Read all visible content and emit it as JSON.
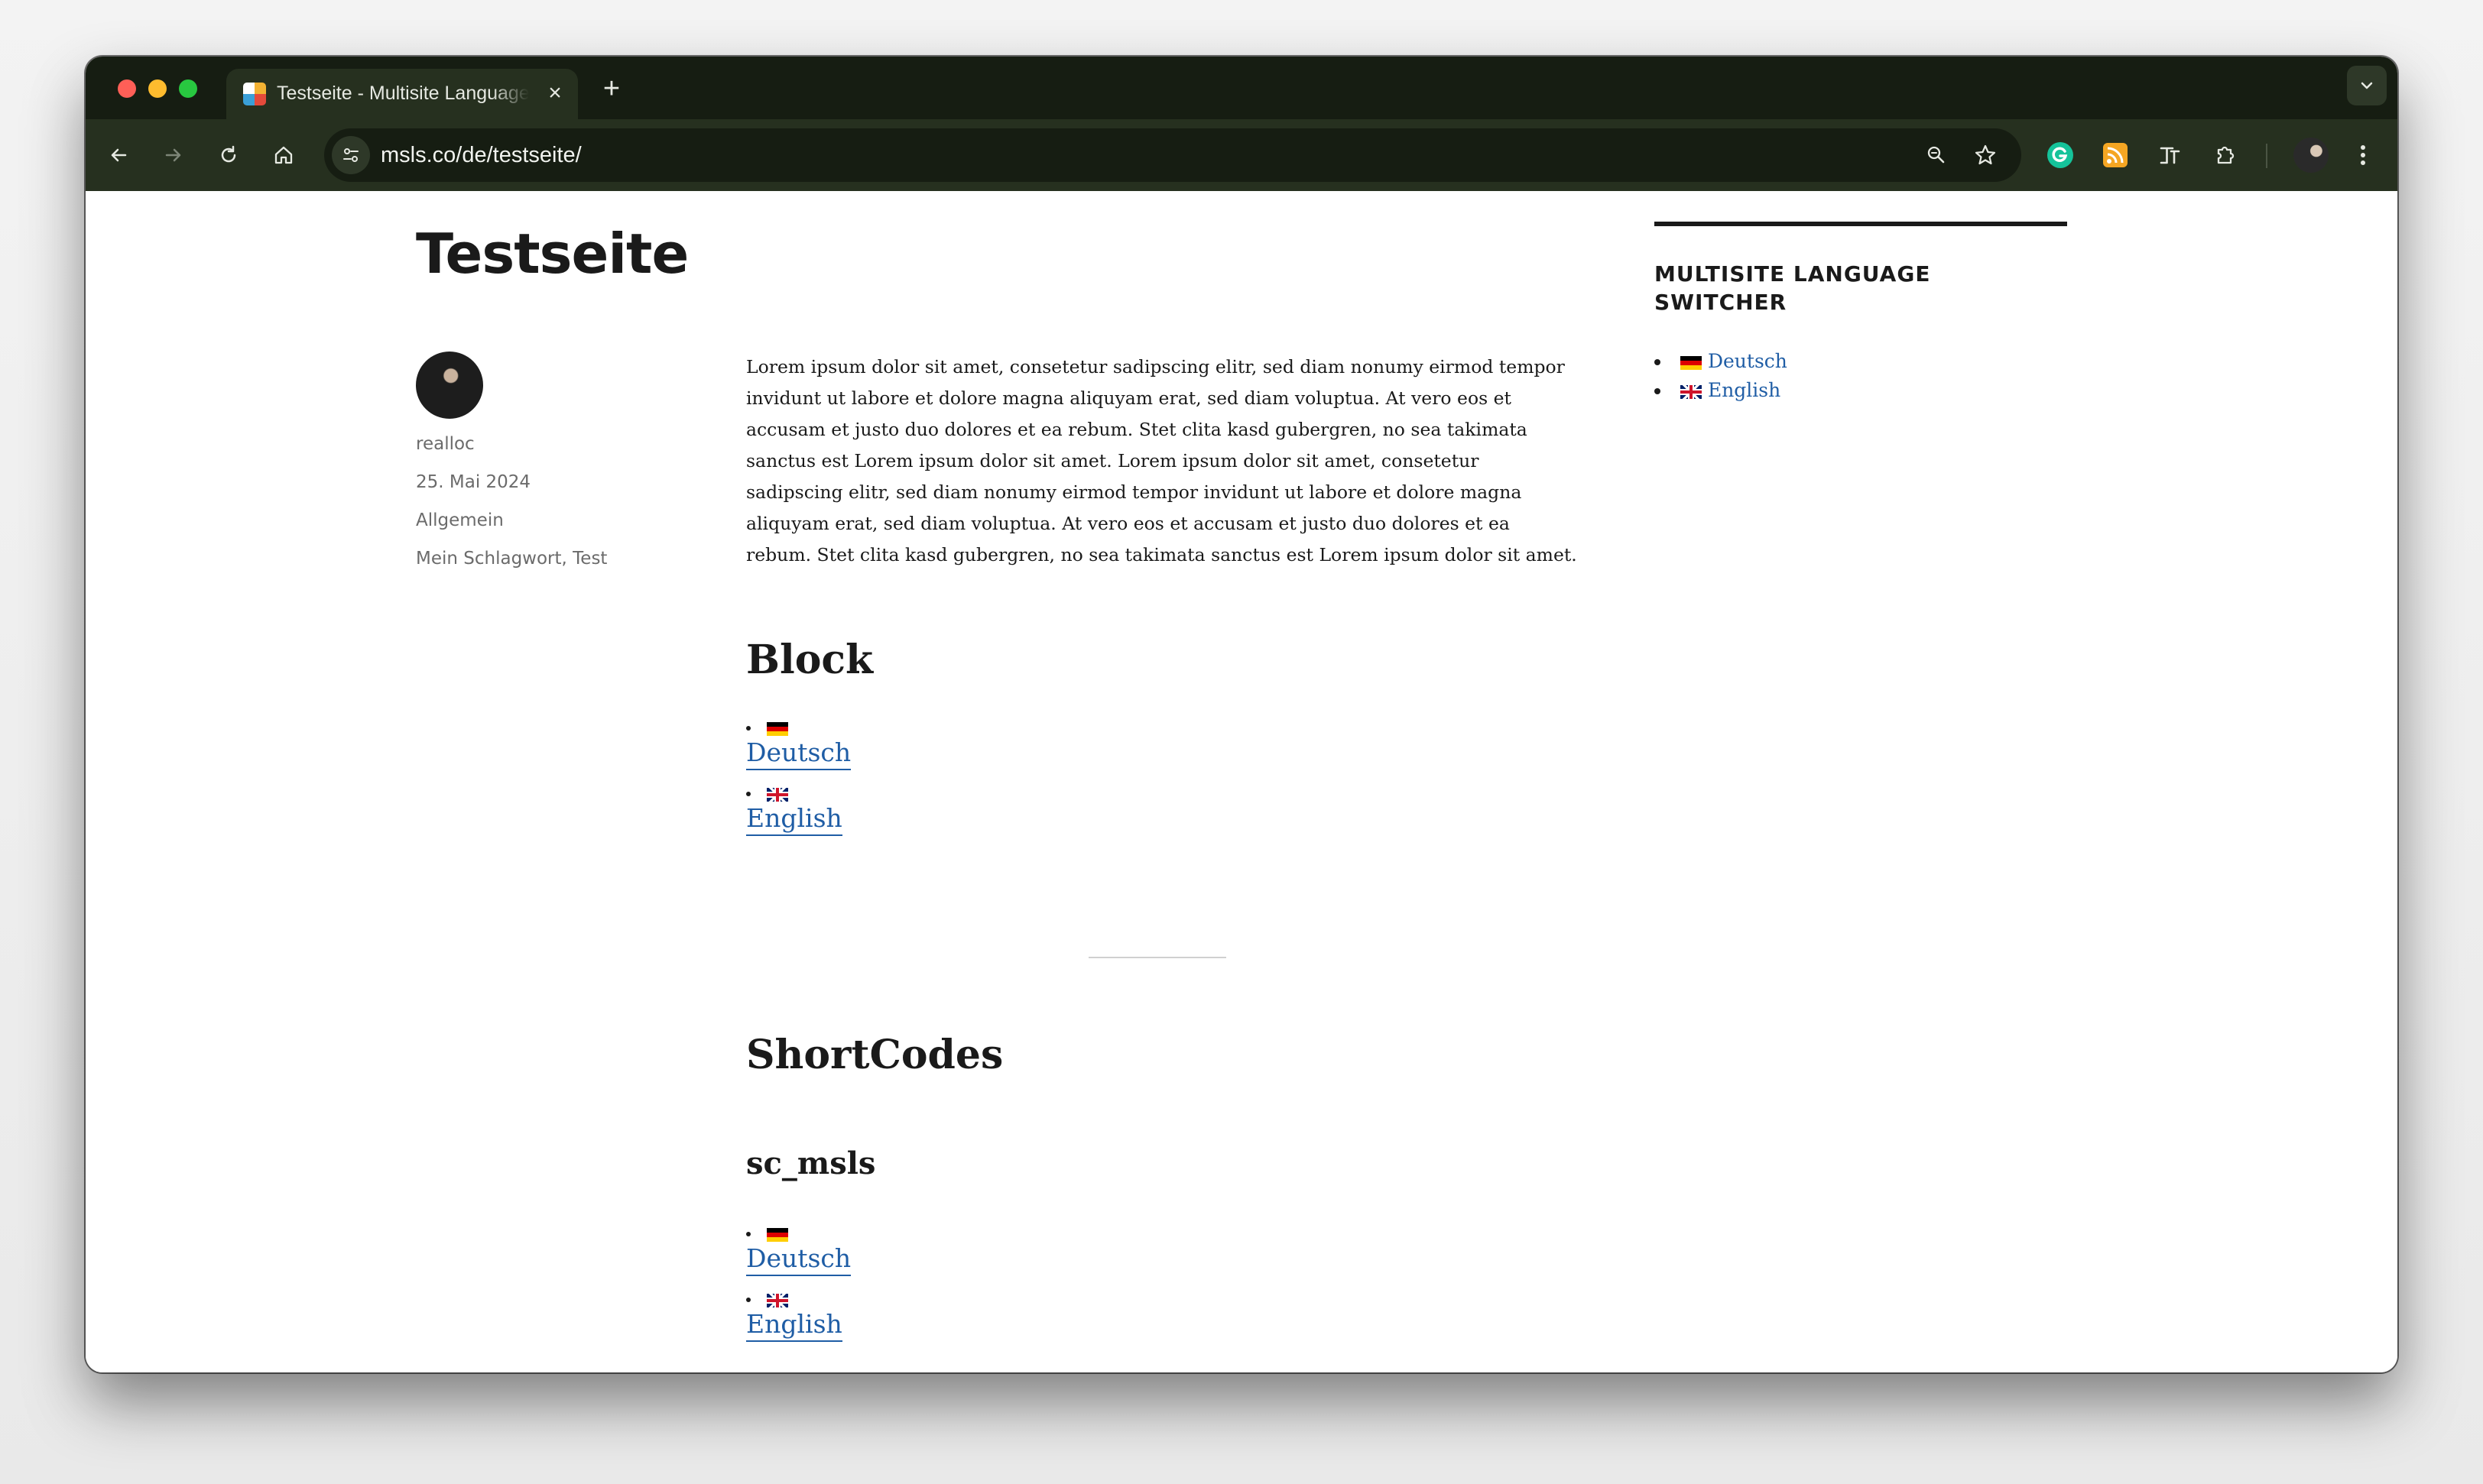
{
  "browser": {
    "tab_title": "Testseite - Multisite Language Switcher",
    "new_tab_label": "+",
    "url": "msls.co/de/testseite/"
  },
  "page": {
    "title": "Testseite",
    "meta": {
      "author": "realloc",
      "date": "25. Mai 2024",
      "category": "Allgemein",
      "tags": "Mein Schlagwort, Test"
    },
    "lorem": "Lorem ipsum dolor sit amet, consetetur sadipscing elitr, sed diam nonumy eirmod tempor invidunt ut labore et dolore magna aliquyam erat, sed diam voluptua. At vero eos et accusam et justo duo dolores et ea rebum. Stet clita kasd gubergren, no sea takimata sanctus est Lorem ipsum dolor sit amet. Lorem ipsum dolor sit amet, consetetur sadipscing elitr, sed diam nonumy eirmod tempor invidunt ut labore et dolore magna aliquyam erat, sed diam voluptua. At vero eos et accusam et justo duo dolores et ea rebum. Stet clita kasd gubergren, no sea takimata sanctus est Lorem ipsum dolor sit amet.",
    "block_heading": "Block",
    "block_languages": [
      "Deutsch",
      "English"
    ],
    "shortcodes_heading": "ShortCodes",
    "sc_heading": "sc_msls",
    "sc_languages": [
      "Deutsch",
      "English"
    ]
  },
  "sidebar": {
    "widget_title": "MULTISITE LANGUAGE SWITCHER",
    "languages": [
      "Deutsch",
      "English"
    ]
  },
  "colors": {
    "tabstrip": "#161d12",
    "toolbar": "#26301f",
    "link": "#1f5da5",
    "text": "#1a1a1a",
    "meta": "#6b6b6b"
  },
  "icons": {
    "flag_de": "german-flag-icon",
    "flag_gb": "uk-flag-icon"
  }
}
